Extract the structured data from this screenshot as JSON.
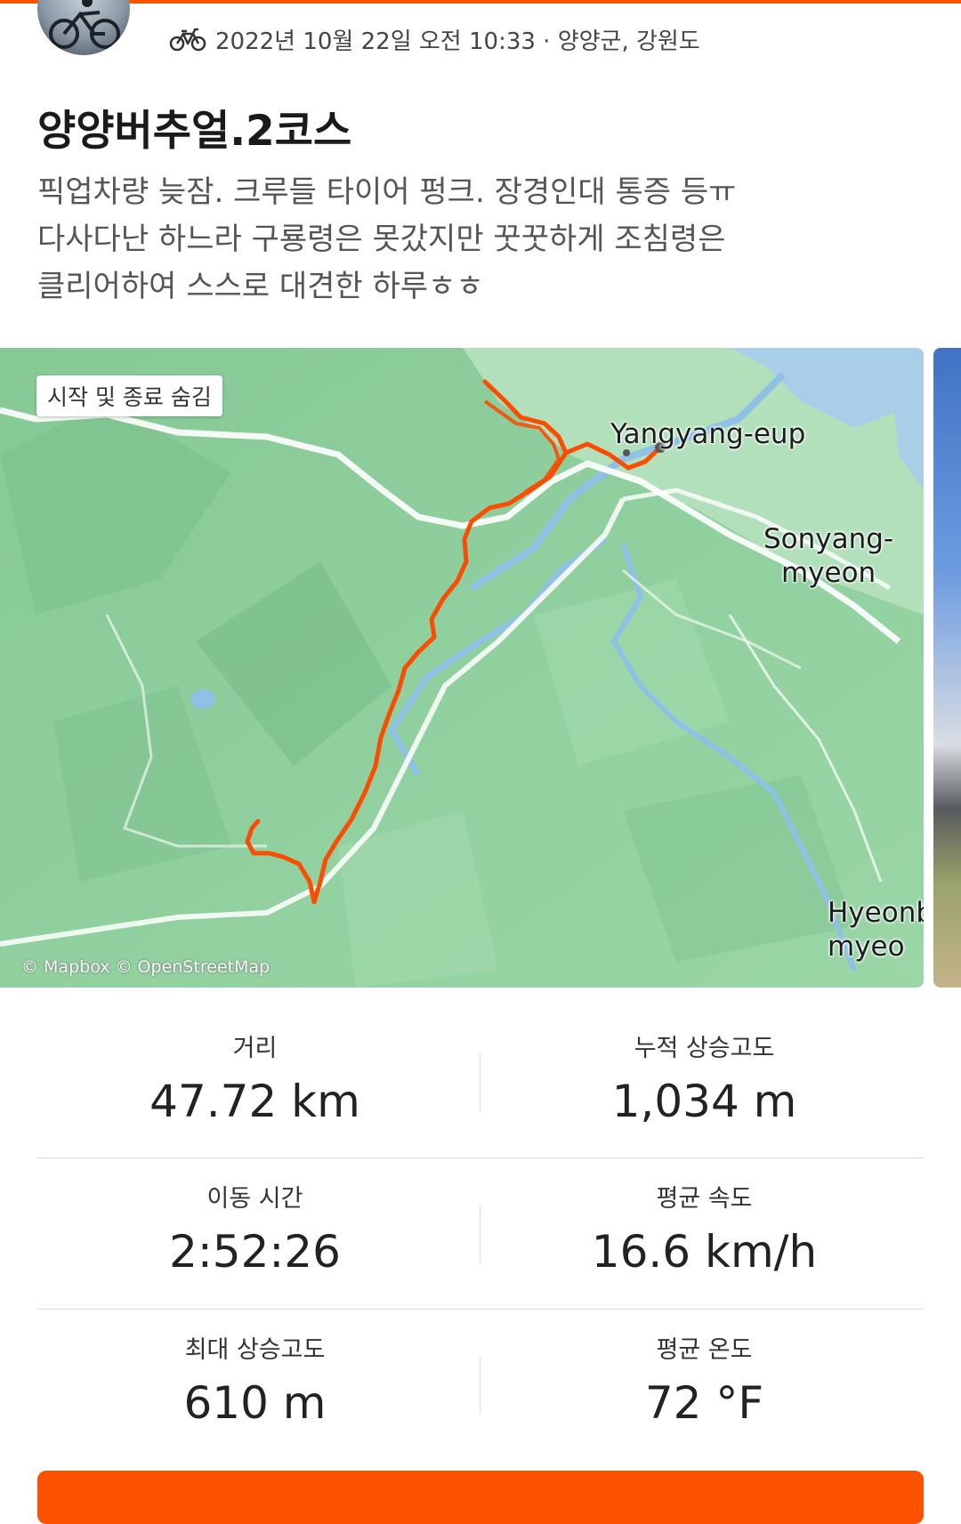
{
  "activity": {
    "datetime_location": "2022년 10월 22일 오전 10:33 · 양양군, 강원도",
    "activity_type_icon": "bike-icon",
    "title": "양양버추얼.2코스",
    "description_lines": [
      "픽업차량 늦잠. 크루들 타이어 펑크. 장경인대 통증 등ㅠ",
      "다사다난 하느라 구룡령은 못갔지만 꿋꿋하게 조침령은",
      "클리어하여 스스로 대견한 하루ㅎㅎ"
    ]
  },
  "map": {
    "hide_start_end": "시작 및 종료 숨김",
    "place_labels": {
      "yangyang": "Yangyang-eup",
      "sonyang": "Sonyang-\nmyeon",
      "hyeonbuk": "Hyeonb\nmyeo"
    },
    "attribution": "© Mapbox © OpenStreetMap",
    "route_color": "#fc4c02"
  },
  "stats": [
    {
      "label": "거리",
      "value": "47.72 km"
    },
    {
      "label": "누적 상승고도",
      "value": "1,034 m"
    },
    {
      "label": "이동 시간",
      "value": "2:52:26"
    },
    {
      "label": "평균 속도",
      "value": "16.6 km/h"
    },
    {
      "label": "최대 상승고도",
      "value": "610 m"
    },
    {
      "label": "평균 온도",
      "value": "72 °F"
    }
  ],
  "colors": {
    "accent": "#fc5200",
    "map_green": "#8fcf9d"
  }
}
